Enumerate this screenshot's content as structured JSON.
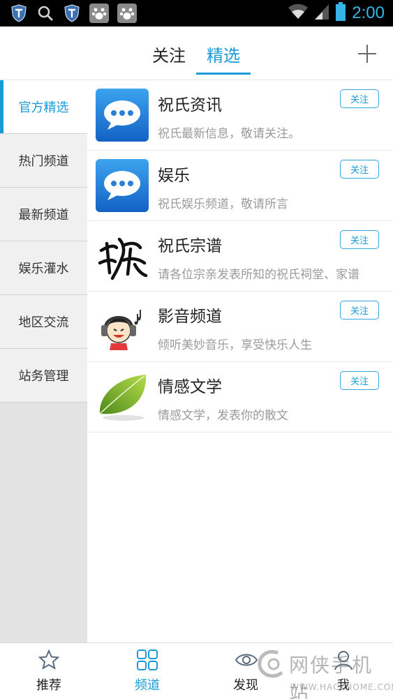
{
  "status_bar": {
    "time": "2:00"
  },
  "header": {
    "tabs": [
      {
        "label": "关注"
      },
      {
        "label": "精选"
      }
    ]
  },
  "sidebar": {
    "items": [
      {
        "label": "官方精选"
      },
      {
        "label": "热门频道"
      },
      {
        "label": "最新频道"
      },
      {
        "label": "娱乐灌水"
      },
      {
        "label": "地区交流"
      },
      {
        "label": "站务管理"
      }
    ]
  },
  "list": {
    "follow_label": "关注",
    "items": [
      {
        "title": "祝氏资讯",
        "subtitle": "祝氏最新信息，敬请关注。",
        "icon": "chat-bubble-icon"
      },
      {
        "title": "娱乐",
        "subtitle": "祝氏娱乐频道，敬请所言",
        "icon": "chat-bubble-icon"
      },
      {
        "title": "祝氏宗谱",
        "subtitle": "请各位宗亲发表所知的祝氏祠堂、家谱",
        "icon": "calligraphy-icon"
      },
      {
        "title": "影音频道",
        "subtitle": "倾听美妙音乐，享受快乐人生",
        "icon": "headphone-boy-icon"
      },
      {
        "title": "情感文学",
        "subtitle": "情感文学，发表你的散文",
        "icon": "green-leaf-icon"
      }
    ]
  },
  "bottom_nav": {
    "items": [
      {
        "label": "推荐",
        "icon": "star-icon"
      },
      {
        "label": "频道",
        "icon": "grid-icon"
      },
      {
        "label": "发现",
        "icon": "eye-icon"
      },
      {
        "label": "我",
        "icon": "person-icon"
      }
    ]
  },
  "watermark": {
    "text": "网侠手机站",
    "url": "WWW.HACKHOME.COM"
  },
  "colors": {
    "accent": "#1a9bd7",
    "statusbar": "#000000",
    "clock": "#34b5e5"
  }
}
